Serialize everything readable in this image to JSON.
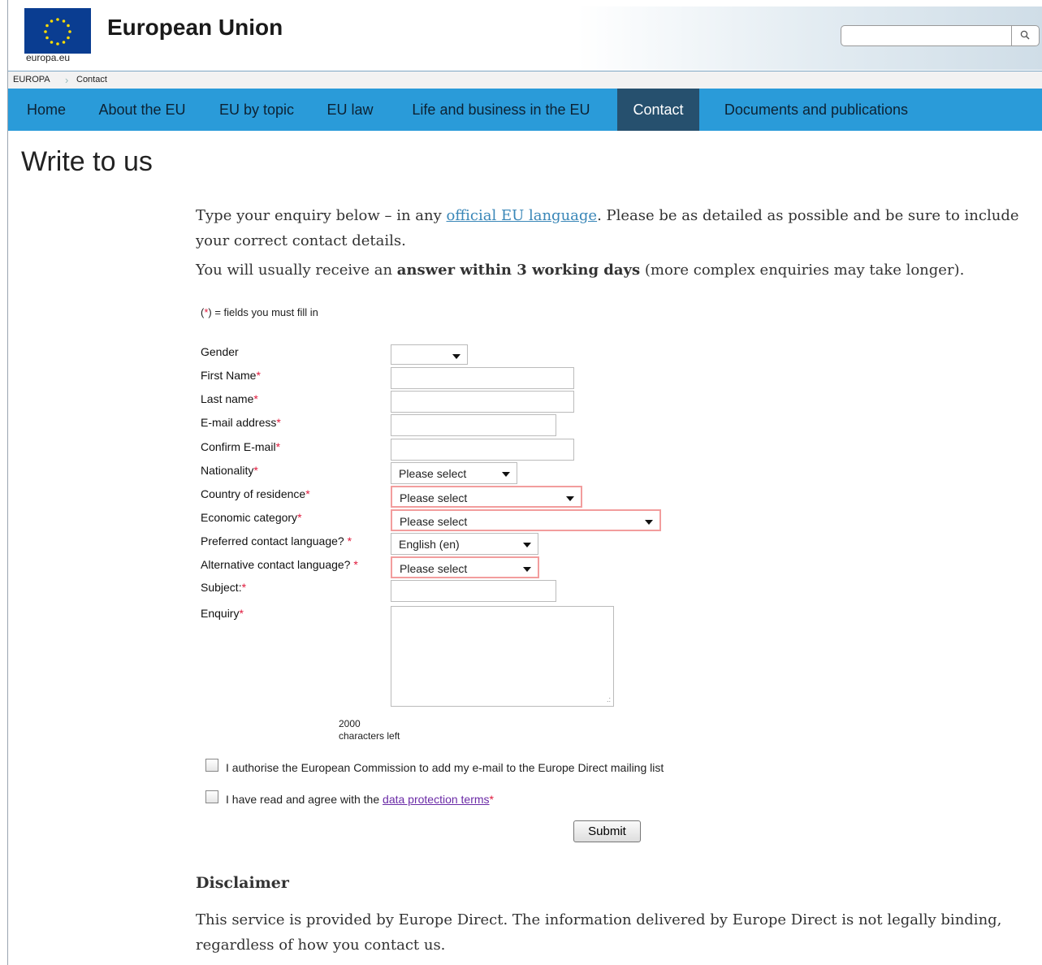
{
  "header": {
    "logo_text": "europa.eu",
    "title": "European Union",
    "search": {
      "value": "",
      "placeholder": ""
    }
  },
  "breadcrumb": {
    "items": [
      "EUROPA",
      "Contact"
    ]
  },
  "nav": {
    "items": [
      {
        "label": "Home"
      },
      {
        "label": "About the EU"
      },
      {
        "label": "EU by topic"
      },
      {
        "label": "EU law"
      },
      {
        "label": "Life and business in the EU"
      },
      {
        "label": "Contact",
        "active": true
      },
      {
        "label": "Documents and publications"
      }
    ]
  },
  "page": {
    "title": "Write to us"
  },
  "intro": {
    "p1_before": "Type your enquiry below – in any ",
    "p1_link": "official EU language",
    "p1_after": ". Please be as detailed as possible and be sure to include your correct contact details.",
    "p2_before": "You will usually receive an ",
    "p2_bold": "answer within 3 working days",
    "p2_after": " (more complex enquiries may take longer)."
  },
  "required_note": {
    "open": "(",
    "star": "*",
    "close": ") = fields you must fill in"
  },
  "form": {
    "gender": {
      "label": "Gender",
      "value": ""
    },
    "first_name": {
      "label": "First Name",
      "value": ""
    },
    "last_name": {
      "label": "Last name",
      "value": ""
    },
    "email": {
      "label": "E-mail address",
      "value": ""
    },
    "confirm_email": {
      "label": "Confirm E-mail",
      "value": ""
    },
    "nationality": {
      "label": "Nationality",
      "value": "Please select"
    },
    "country": {
      "label": "Country of residence",
      "value": "Please select"
    },
    "economic": {
      "label": "Economic category",
      "value": "Please select"
    },
    "pref_lang": {
      "label": "Preferred contact language? ",
      "value": "English (en)"
    },
    "alt_lang": {
      "label": "Alternative contact language? ",
      "value": "Please select"
    },
    "subject": {
      "label": "Subject:",
      "value": ""
    },
    "enquiry": {
      "label": "Enquiry",
      "value": ""
    },
    "chars_count": "2000",
    "chars_text": "characters left",
    "required_mark": "*",
    "checkbox_mailing": {
      "label": "I authorise the European Commission to add my e-mail to the Europe Direct mailing list",
      "checked": false
    },
    "checkbox_terms": {
      "label_before": "I have read and agree with the ",
      "link": "data protection terms",
      "checked": false
    },
    "submit_label": "Submit"
  },
  "disclaimer": {
    "title": "Disclaimer",
    "text": "This service is provided by Europe Direct. The information delivered by Europe Direct is not legally binding, regardless of how you contact us."
  },
  "colors": {
    "nav_bg": "#2a9bd9",
    "nav_active_bg": "#26506e",
    "required_star": "#e0193c",
    "error_border": "#f29d9d",
    "link": "#3a87b8"
  }
}
